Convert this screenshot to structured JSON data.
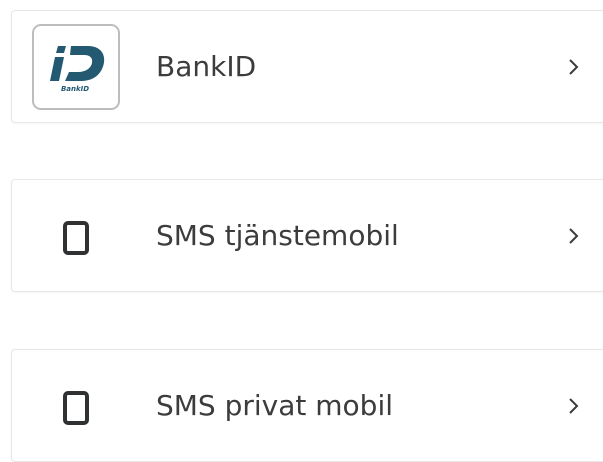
{
  "options": [
    {
      "label": "BankID",
      "icon": "bankid-logo-icon",
      "logo_text": "BankID"
    },
    {
      "label": "SMS tjänstemobil",
      "icon": "mobile-phone-icon"
    },
    {
      "label": "SMS privat mobil",
      "icon": "mobile-phone-icon"
    }
  ],
  "colors": {
    "bankid_blue": "#235971",
    "icon_dark": "#2f3133",
    "text": "#3c3c3c",
    "border": "#e7e7e7"
  }
}
